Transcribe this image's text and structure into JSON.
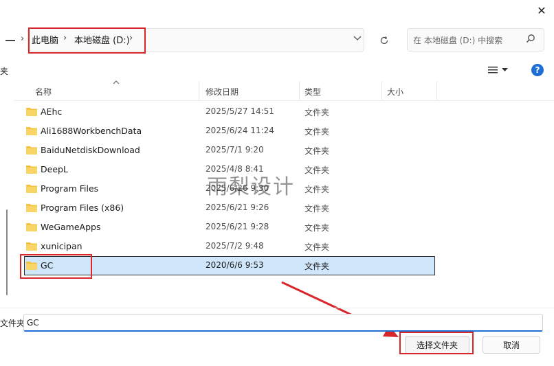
{
  "window": {
    "close_glyph": "✕"
  },
  "address": {
    "breadcrumbs": [
      "此电脑",
      "本地磁盘 (D:)"
    ],
    "separator": "›",
    "dropdown_glyph": "⌄"
  },
  "search": {
    "placeholder": "在 本地磁盘 (D:) 中搜索"
  },
  "toolbar": {
    "partial_label": "夹",
    "help_glyph": "?"
  },
  "columns": {
    "name": "名称",
    "date": "修改日期",
    "type": "类型",
    "size": "大小"
  },
  "files": [
    {
      "name": "AEhc",
      "date": "2025/5/27 14:51",
      "type": "文件夹"
    },
    {
      "name": "Ali1688WorkbenchData",
      "date": "2025/6/24 11:24",
      "type": "文件夹"
    },
    {
      "name": "BaiduNetdiskDownload",
      "date": "2025/7/1 9:20",
      "type": "文件夹"
    },
    {
      "name": "DeepL",
      "date": "2025/4/8 8:41",
      "type": "文件夹"
    },
    {
      "name": "Program Files",
      "date": "2025/6/26 9:30",
      "type": "文件夹"
    },
    {
      "name": "Program Files (x86)",
      "date": "2025/6/21 9:26",
      "type": "文件夹"
    },
    {
      "name": "WeGameApps",
      "date": "2025/6/21 9:28",
      "type": "文件夹"
    },
    {
      "name": "xunicipan",
      "date": "2025/7/2 9:48",
      "type": "文件夹"
    },
    {
      "name": "GC",
      "date": "2020/6/6 9:53",
      "type": "文件夹",
      "selected": true
    }
  ],
  "watermark": "雨梨设计",
  "footer": {
    "folder_label": "文件夹:",
    "folder_value": "GC",
    "select_button": "选择文件夹",
    "cancel_button": "取消"
  },
  "colors": {
    "accent": "#1e6ed6",
    "selection": "#cfe6fb",
    "annotation": "#d8262a",
    "folder": "#f4c342"
  }
}
